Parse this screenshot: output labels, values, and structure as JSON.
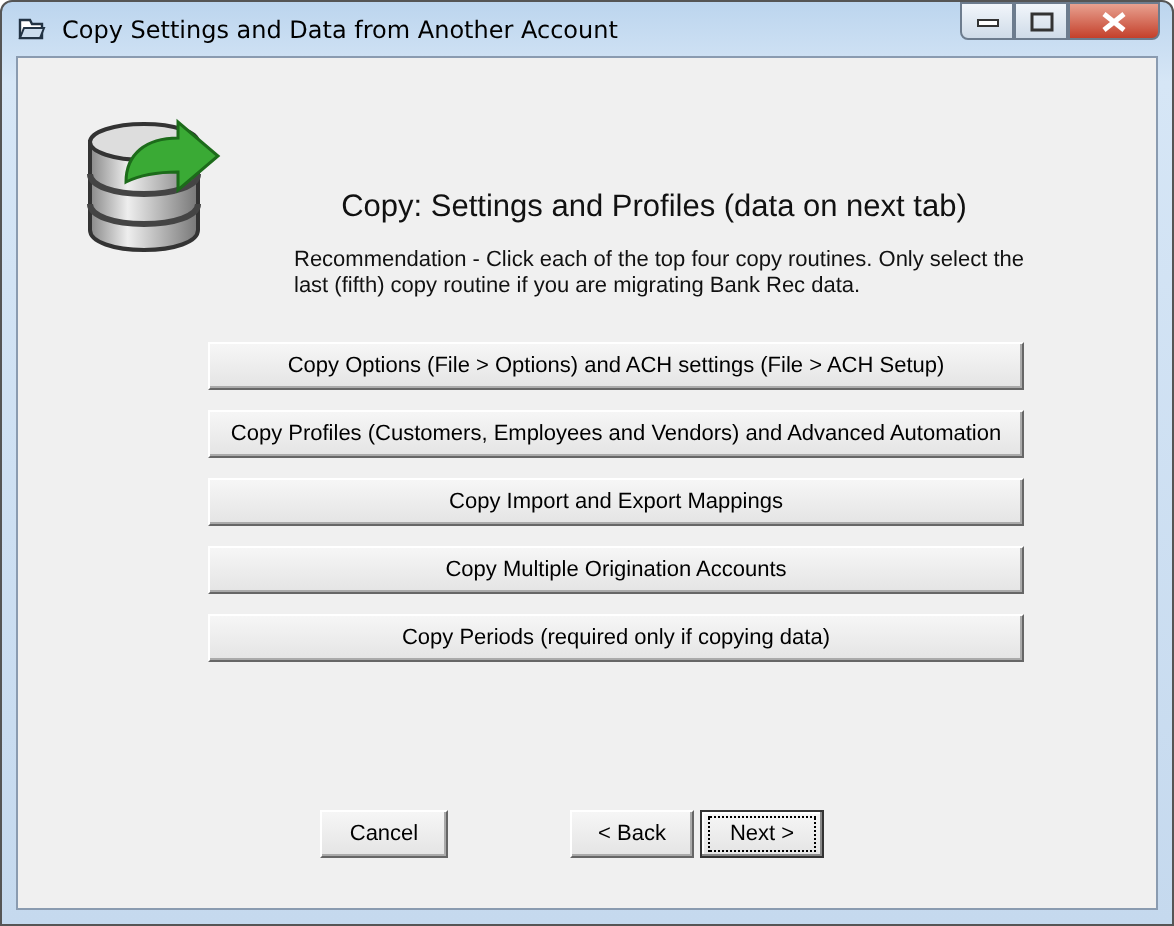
{
  "window": {
    "title": "Copy Settings and Data from Another Account"
  },
  "heading": "Copy: Settings and Profiles (data on next tab)",
  "recommendation": "Recommendation - Click each of the top four copy routines.  Only select the last (fifth) copy routine if you are migrating Bank Rec data.",
  "copy_buttons": [
    {
      "label": "Copy Options (File > Options) and ACH settings (File > ACH Setup)"
    },
    {
      "label": "Copy Profiles (Customers, Employees and Vendors) and Advanced Automation"
    },
    {
      "label": "Copy Import and Export Mappings"
    },
    {
      "label": "Copy Multiple Origination Accounts"
    },
    {
      "label": "Copy Periods (required only if copying data)"
    }
  ],
  "nav_buttons": [
    {
      "label": "Cancel",
      "default": false,
      "kind": "cancel"
    },
    {
      "label": "< Back",
      "default": false,
      "kind": "back"
    },
    {
      "label": "Next >",
      "default": true,
      "kind": "next"
    }
  ]
}
